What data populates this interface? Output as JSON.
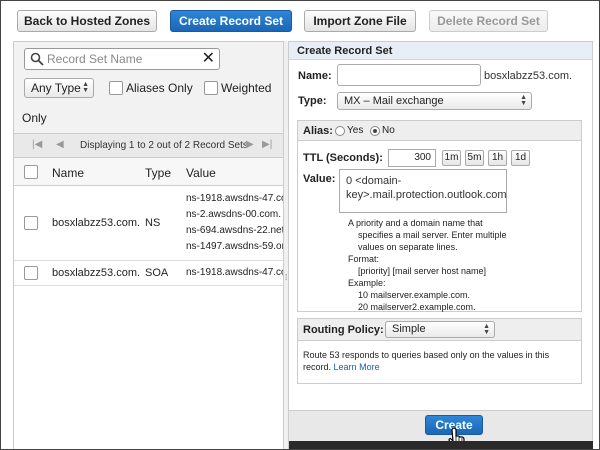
{
  "toolbar": {
    "back_label": "Back to Hosted Zones",
    "create_record_set_label": "Create Record Set",
    "import_zone_label": "Import Zone File",
    "delete_record_set_label": "Delete Record Set"
  },
  "filter": {
    "search_placeholder": "Record Set Name",
    "clear_symbol": "✕",
    "type_select": "Any Type",
    "aliases_only_label": "Aliases Only",
    "weighted_label": "Weighted",
    "only_label": "Only"
  },
  "pager": {
    "text": "Displaying 1 to 2 out of 2 Record Sets",
    "first": "|◀",
    "prev": "◀",
    "next": "▶",
    "last": "▶|"
  },
  "grid": {
    "columns": [
      "Name",
      "Type",
      "Value"
    ],
    "rows": [
      {
        "name": "bosxlabzz53.com.",
        "type": "NS",
        "values": [
          "ns-1918.awsdns-47.co",
          "ns-2.awsdns-00.com.",
          "ns-694.awsdns-22.net.",
          "ns-1497.awsdns-59.org"
        ]
      },
      {
        "name": "bosxlabzz53.com.",
        "type": "SOA",
        "values": [
          "ns-1918.awsdns-47.co"
        ]
      }
    ]
  },
  "form": {
    "header": "Create Record Set",
    "name_label": "Name:",
    "name_value": "",
    "name_suffix": "bosxlabzz53.com.",
    "type_label": "Type:",
    "type_value": "MX – Mail exchange",
    "alias_label": "Alias:",
    "alias_yes": "Yes",
    "alias_no": "No",
    "ttl_label": "TTL (Seconds):",
    "ttl_value": "300",
    "ttl_buttons": [
      "1m",
      "5m",
      "1h",
      "1d"
    ],
    "value_label": "Value:",
    "value_text_line1": "0 <domain-",
    "value_text_line2": "key>.mail.protection.outlook.com.",
    "help_lines": [
      "A priority and a domain name that",
      "    specifies a mail server. Enter multiple",
      "    values on separate lines.",
      "Format:",
      "    [priority] [mail server host name]",
      "Example:",
      "    10 mailserver.example.com.",
      "    20 mailserver2.example.com."
    ],
    "routing_label": "Routing Policy:",
    "routing_value": "Simple",
    "routing_desc": "Route 53 responds to queries based only on the values in this record.",
    "learn_more_1": "Learn",
    "learn_more_2": "More",
    "create_button": "Create"
  },
  "colors": {
    "primary_blue": "#1a67b6",
    "link_blue": "#1a5fb4",
    "header_blue_tint": "#e8eef6"
  }
}
